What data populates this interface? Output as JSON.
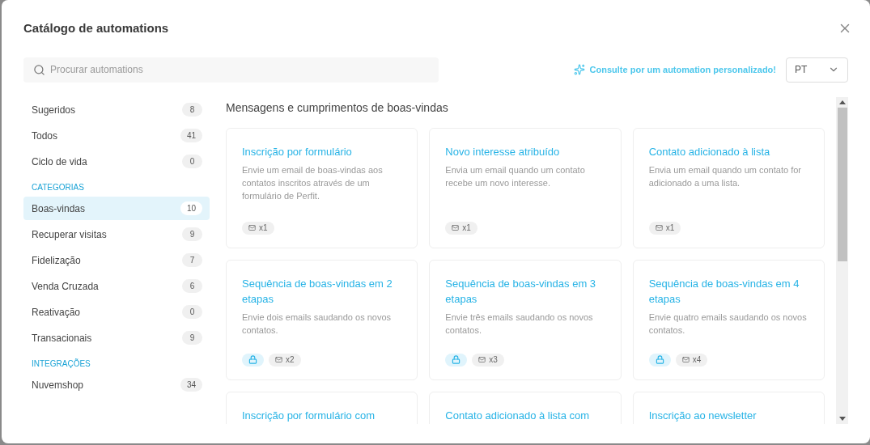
{
  "dialog": {
    "title": "Catálogo de automations"
  },
  "search": {
    "placeholder": "Procurar automations"
  },
  "custom_link": "Consulte por um automation personalizado!",
  "language": {
    "value": "PT"
  },
  "sidebar": {
    "sections": [
      {
        "items": [
          {
            "label": "Sugeridos",
            "count": "8",
            "selected": false
          },
          {
            "label": "Todos",
            "count": "41",
            "selected": false
          },
          {
            "label": "Ciclo de vida",
            "count": "0",
            "selected": false
          }
        ]
      },
      {
        "heading": "CATEGORIAS",
        "items": [
          {
            "label": "Boas-vindas",
            "count": "10",
            "selected": true
          },
          {
            "label": "Recuperar visitas",
            "count": "9",
            "selected": false
          },
          {
            "label": "Fidelização",
            "count": "7",
            "selected": false
          },
          {
            "label": "Venda Cruzada",
            "count": "6",
            "selected": false
          },
          {
            "label": "Reativação",
            "count": "0",
            "selected": false
          },
          {
            "label": "Transacionais",
            "count": "9",
            "selected": false
          }
        ]
      },
      {
        "heading": "INTEGRAÇÕES",
        "items": [
          {
            "label": "Nuvemshop",
            "count": "34",
            "selected": false
          }
        ]
      }
    ]
  },
  "section_title": "Mensagens e cumprimentos de boas-vindas",
  "cards": [
    {
      "title": "Inscrição por formulário",
      "description": "Envie um email de boas-vindas aos contatos inscritos através de um formulário de Perfit.",
      "locked": false,
      "emails": "x1"
    },
    {
      "title": "Novo interesse atribuído",
      "description": "Envia um email quando um contato recebe um novo interesse.",
      "locked": false,
      "emails": "x1"
    },
    {
      "title": "Contato adicionado à lista",
      "description": "Envia um email quando um contato for adicionado a uma lista.",
      "locked": false,
      "emails": "x1"
    },
    {
      "title": "Sequência de boas-vindas em 2 etapas",
      "description": "Envie dois emails saudando os novos contatos.",
      "locked": true,
      "emails": "x2"
    },
    {
      "title": "Sequência de boas-vindas em 3 etapas",
      "description": "Envie três emails saudando os novos contatos.",
      "locked": true,
      "emails": "x3"
    },
    {
      "title": "Sequência de boas-vindas em 4 etapas",
      "description": "Envie quatro emails saudando os novos contatos.",
      "locked": true,
      "emails": "x4"
    },
    {
      "title": "Inscrição por formulário com"
    },
    {
      "title": "Contato adicionado à lista com"
    },
    {
      "title": "Inscrição ao newsletter"
    }
  ]
}
